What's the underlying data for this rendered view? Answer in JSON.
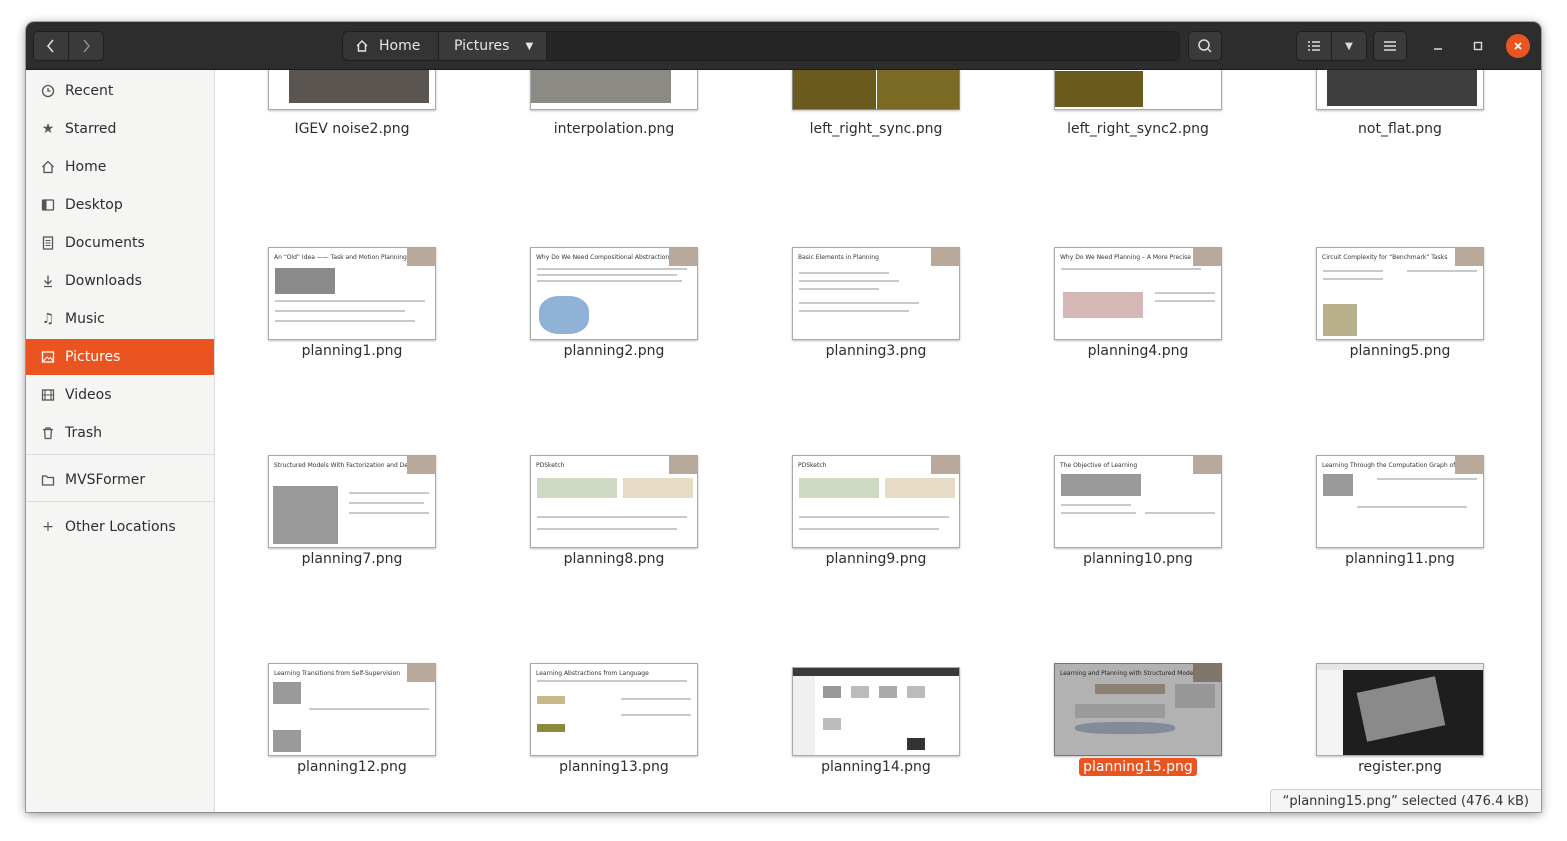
{
  "path": {
    "home": "Home",
    "current": "Pictures"
  },
  "icons": {
    "back": "go-back-icon",
    "forward": "go-forward-icon",
    "home": "home-icon",
    "dropdown": "chevron-down-icon",
    "search": "search-icon",
    "list": "list-view-icon",
    "menu": "hamburger-menu-icon",
    "minimize": "minimize-icon",
    "maximize": "maximize-icon",
    "close": "close-icon"
  },
  "sidebar": {
    "items": [
      {
        "label": "Recent",
        "icon": "clock-icon"
      },
      {
        "label": "Starred",
        "icon": "star-icon"
      },
      {
        "label": "Home",
        "icon": "home-icon"
      },
      {
        "label": "Desktop",
        "icon": "desktop-icon"
      },
      {
        "label": "Documents",
        "icon": "document-icon"
      },
      {
        "label": "Downloads",
        "icon": "download-icon"
      },
      {
        "label": "Music",
        "icon": "music-icon"
      },
      {
        "label": "Pictures",
        "icon": "picture-icon"
      },
      {
        "label": "Videos",
        "icon": "video-icon"
      },
      {
        "label": "Trash",
        "icon": "trash-icon"
      }
    ],
    "bookmarks": [
      {
        "label": "MVSFormer",
        "icon": "folder-icon"
      }
    ],
    "other": {
      "label": "Other Locations",
      "icon": "plus-icon"
    }
  },
  "files": {
    "row0": [
      "IGEV noise2.png",
      "interpolation.png",
      "left_right_sync.png",
      "left_right_sync2.png",
      "not_flat.png"
    ],
    "row1": [
      "planning1.png",
      "planning2.png",
      "planning3.png",
      "planning4.png",
      "planning5.png"
    ],
    "row2": [
      "planning7.png",
      "planning8.png",
      "planning9.png",
      "planning10.png",
      "planning11.png"
    ],
    "row3": [
      "planning12.png",
      "planning13.png",
      "planning14.png",
      "planning15.png",
      "register.png"
    ]
  },
  "thumb_titles": {
    "row1": [
      "An “Old” Idea —— Task and Motion Planning",
      "Why Do We Need Compositional Abstraction",
      "Basic Elements in Planning",
      "Why Do We Need Planning – A More Precise Sta",
      "Circuit Complexity for “Benchmark” Tasks"
    ],
    "row2": [
      "Structured Models With Factorization and Deco",
      "PDSketch",
      "PDSketch",
      "The Objective of Learning",
      "Learning Through the Computation Graph of Pre"
    ],
    "row3": [
      "Learning Transitions from Self-Supervision",
      "Learning Abstractions from Language",
      "",
      "Learning and Planning with Structured Mode",
      ""
    ]
  },
  "selected_file": "planning15.png",
  "status": "“planning15.png” selected  (476.4 kB)",
  "colors": {
    "accent": "#e95420",
    "headerbar": "#2d2d2d"
  }
}
